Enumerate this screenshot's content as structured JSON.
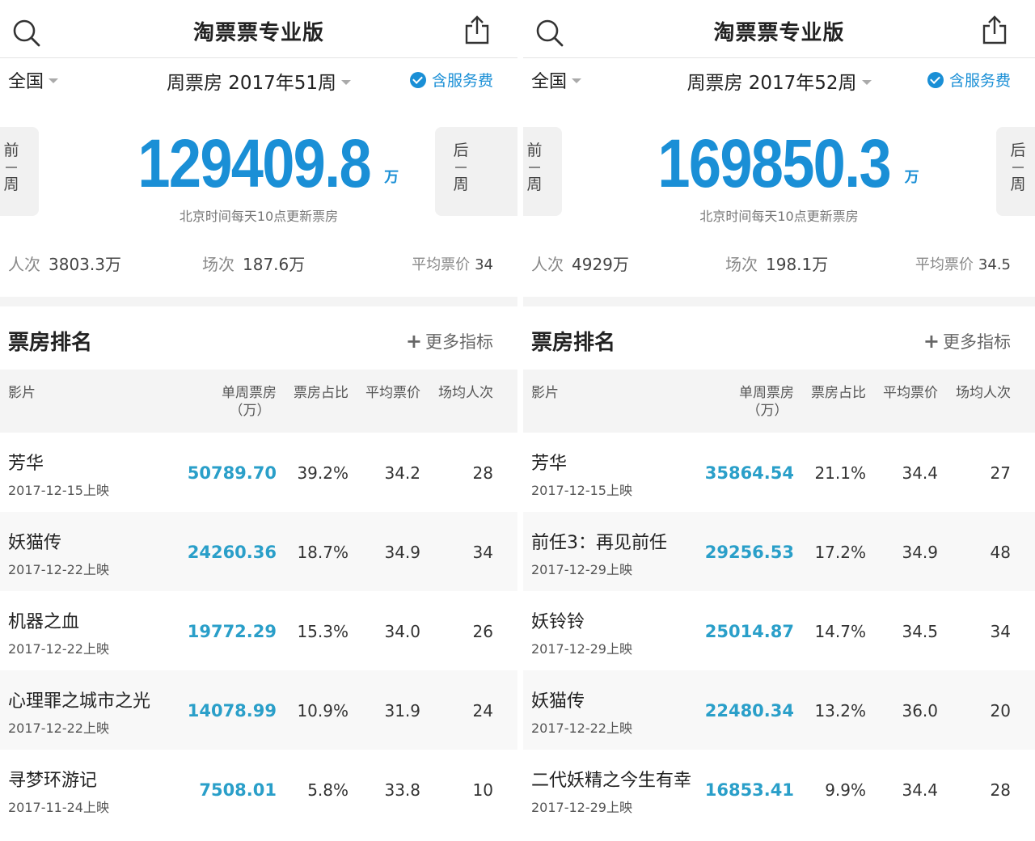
{
  "panels": [
    {
      "app_title": "淘票票专业版",
      "region": "全国",
      "period_label": "周票房 2017年51周",
      "service_fee": "含服务费",
      "prev_label": [
        "前",
        "周"
      ],
      "next_label": [
        "后",
        "周"
      ],
      "show_next": false,
      "total_gross": "129409.8",
      "total_unit": "万",
      "update_note": "北京时间每天10点更新票房",
      "stats": {
        "admissions_label": "人次",
        "admissions_value": "3803.3万",
        "screenings_label": "场次",
        "screenings_value": "187.6万",
        "avg_price_label": "平均票价",
        "avg_price_value": "34"
      },
      "ranking": {
        "title": "票房排名",
        "more": "更多指标",
        "headers": {
          "film": "影片",
          "gross": "单周票房",
          "gross_unit": "（万）",
          "share": "票房占比",
          "avg_price": "平均票价",
          "avg_per_show": "场均人次"
        },
        "rows": [
          {
            "name": "芳华",
            "release": "2017-12-15上映",
            "gross": "50789.70",
            "share": "39.2%",
            "avg_price": "34.2",
            "avg_per_show": "28"
          },
          {
            "name": "妖猫传",
            "release": "2017-12-22上映",
            "gross": "24260.36",
            "share": "18.7%",
            "avg_price": "34.9",
            "avg_per_show": "34"
          },
          {
            "name": "机器之血",
            "release": "2017-12-22上映",
            "gross": "19772.29",
            "share": "15.3%",
            "avg_price": "34.0",
            "avg_per_show": "26"
          },
          {
            "name": "心理罪之城市之光",
            "release": "2017-12-22上映",
            "gross": "14078.99",
            "share": "10.9%",
            "avg_price": "31.9",
            "avg_per_show": "24"
          },
          {
            "name": "寻梦环游记",
            "release": "2017-11-24上映",
            "gross": "7508.01",
            "share": "5.8%",
            "avg_price": "33.8",
            "avg_per_show": "10"
          }
        ]
      }
    },
    {
      "app_title": "淘票票专业版",
      "region": "全国",
      "period_label": "周票房 2017年52周",
      "service_fee": "含服务费",
      "prev_label": [
        "前",
        "周"
      ],
      "next_label": [
        "后",
        "周"
      ],
      "show_next": true,
      "total_gross": "169850.3",
      "total_unit": "万",
      "update_note": "北京时间每天10点更新票房",
      "stats": {
        "admissions_label": "人次",
        "admissions_value": "4929万",
        "screenings_label": "场次",
        "screenings_value": "198.1万",
        "avg_price_label": "平均票价",
        "avg_price_value": "34.5"
      },
      "ranking": {
        "title": "票房排名",
        "more": "更多指标",
        "headers": {
          "film": "影片",
          "gross": "单周票房",
          "gross_unit": "（万）",
          "share": "票房占比",
          "avg_price": "平均票价",
          "avg_per_show": "场均人次"
        },
        "rows": [
          {
            "name": "芳华",
            "release": "2017-12-15上映",
            "gross": "35864.54",
            "share": "21.1%",
            "avg_price": "34.4",
            "avg_per_show": "27"
          },
          {
            "name": "前任3：再见前任",
            "release": "2017-12-29上映",
            "gross": "29256.53",
            "share": "17.2%",
            "avg_price": "34.9",
            "avg_per_show": "48"
          },
          {
            "name": "妖铃铃",
            "release": "2017-12-29上映",
            "gross": "25014.87",
            "share": "14.7%",
            "avg_price": "34.5",
            "avg_per_show": "34"
          },
          {
            "name": "妖猫传",
            "release": "2017-12-22上映",
            "gross": "22480.34",
            "share": "13.2%",
            "avg_price": "36.0",
            "avg_per_show": "20"
          },
          {
            "name": "二代妖精之今生有幸",
            "release": "2017-12-29上映",
            "gross": "16853.41",
            "share": "9.9%",
            "avg_price": "34.4",
            "avg_per_show": "28"
          }
        ]
      }
    }
  ]
}
